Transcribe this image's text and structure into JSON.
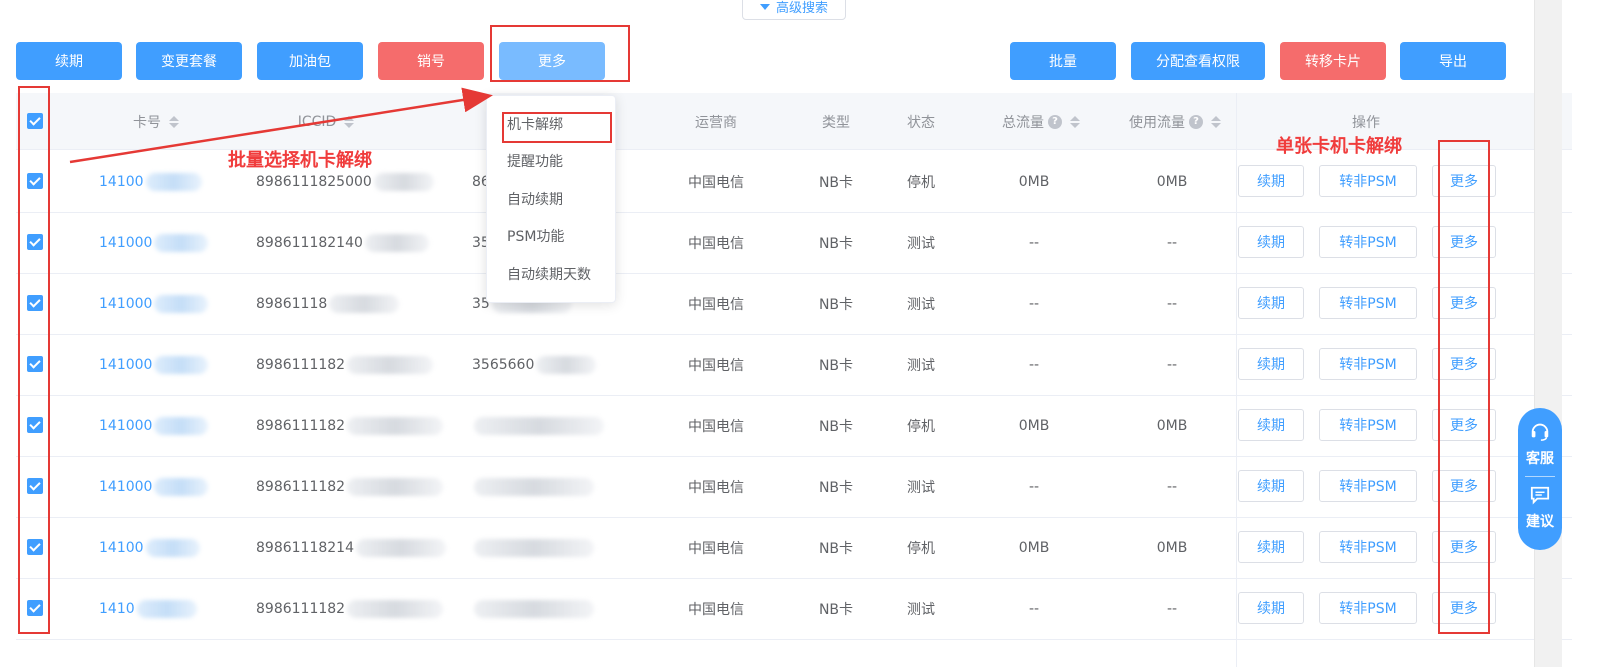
{
  "advanced_search": {
    "label": "高级搜索"
  },
  "toolbar": {
    "renew": "续期",
    "change_plan": "变更套餐",
    "fuel_pack": "加油包",
    "cancel": "销号",
    "more": "更多",
    "batch": "批量",
    "assign_view": "分配查看权限",
    "transfer_card": "转移卡片",
    "export": "导出"
  },
  "table": {
    "headers": {
      "card_no": "卡号",
      "iccid": "ICCID",
      "carrier": "运营商",
      "type": "类型",
      "status": "状态",
      "total_flow": "总流量",
      "used_flow": "使用流量",
      "actions": "操作"
    },
    "rows": [
      {
        "card_no": "14100",
        "iccid": "8986111825000",
        "imei": "86",
        "carrier": "中国电信",
        "type": "NB卡",
        "status": "停机",
        "total": "0MB",
        "used": "0MB"
      },
      {
        "card_no": "141000",
        "iccid": "898611182140",
        "imei": "35",
        "carrier": "中国电信",
        "type": "NB卡",
        "status": "测试",
        "total": "--",
        "used": "--"
      },
      {
        "card_no": "141000",
        "iccid": "89861118",
        "imei": "35",
        "carrier": "中国电信",
        "type": "NB卡",
        "status": "测试",
        "total": "--",
        "used": "--"
      },
      {
        "card_no": "141000",
        "iccid": "8986111182",
        "imei": "3565660",
        "carrier": "中国电信",
        "type": "NB卡",
        "status": "测试",
        "total": "--",
        "used": "--"
      },
      {
        "card_no": "141000",
        "iccid": "8986111182",
        "imei": "",
        "carrier": "中国电信",
        "type": "NB卡",
        "status": "停机",
        "total": "0MB",
        "used": "0MB"
      },
      {
        "card_no": "141000",
        "iccid": "8986111182",
        "imei": "",
        "carrier": "中国电信",
        "type": "NB卡",
        "status": "测试",
        "total": "--",
        "used": "--"
      },
      {
        "card_no": "14100",
        "iccid": "89861118214",
        "imei": "",
        "carrier": "中国电信",
        "type": "NB卡",
        "status": "停机",
        "total": "0MB",
        "used": "0MB"
      },
      {
        "card_no": "1410",
        "iccid": "8986111182",
        "imei": "",
        "carrier": "中国电信",
        "type": "NB卡",
        "status": "测试",
        "total": "--",
        "used": "--"
      }
    ],
    "row_actions": {
      "renew": "续期",
      "to_non_psm": "转非PSM",
      "more": "更多"
    }
  },
  "more_menu": {
    "items": [
      "机卡解绑",
      "提醒功能",
      "自动续期",
      "PSM功能",
      "自动续期天数"
    ]
  },
  "annotations": {
    "batch_note": "批量选择机卡解绑",
    "single_note": "单张卡机卡解绑"
  },
  "side_widget": {
    "service": "客服",
    "suggest": "建议"
  },
  "colors": {
    "primary": "#409eff",
    "danger": "#f56c6c",
    "annotation": "#e53935"
  }
}
